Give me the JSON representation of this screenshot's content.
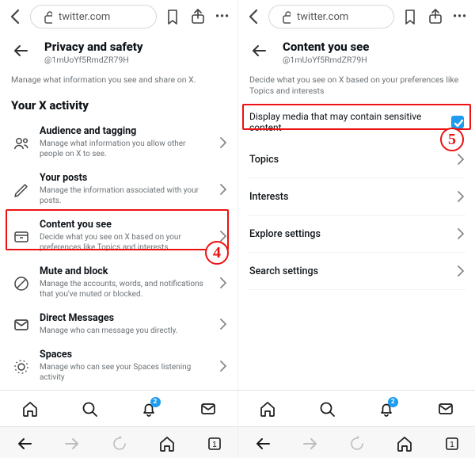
{
  "url": "twitter.com",
  "left": {
    "title": "Privacy and safety",
    "handle": "@1mUoYf5RmdZR79H",
    "desc": "Manage what information you see and share on X.",
    "section": "Your X activity",
    "rows": [
      {
        "title": "Audience and tagging",
        "sub": "Manage what information you allow other people on X to see."
      },
      {
        "title": "Your posts",
        "sub": "Manage the information associated with your posts."
      },
      {
        "title": "Content you see",
        "sub": "Decide what you see on X based on your preferences like Topics and interests"
      },
      {
        "title": "Mute and block",
        "sub": "Manage the accounts, words, and notifications that you've muted or blocked."
      },
      {
        "title": "Direct Messages",
        "sub": "Manage who can message you directly."
      },
      {
        "title": "Spaces",
        "sub": "Manage who can see your Spaces listening activity"
      }
    ],
    "step_num": "4"
  },
  "right": {
    "title": "Content you see",
    "handle": "@1mUoYf5RmdZR79H",
    "desc": "Decide what you see on X based on your preferences like Topics and interests",
    "sensitive_label": "Display media that may contain sensitive content",
    "rows": [
      {
        "title": "Topics"
      },
      {
        "title": "Interests"
      },
      {
        "title": "Explore settings"
      },
      {
        "title": "Search settings"
      }
    ],
    "step_num": "5"
  },
  "notif_badge": "2"
}
